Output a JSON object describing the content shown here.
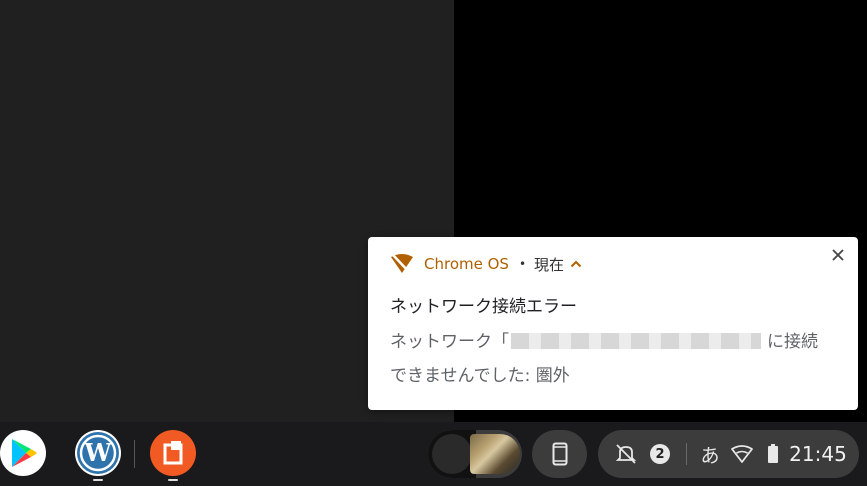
{
  "notification": {
    "app_name": "Chrome OS",
    "separator": "•",
    "time": "現在",
    "title": "ネットワーク接続エラー",
    "body_prefix": "ネットワーク「",
    "body_suffix": "に接続できませんでした: 圏外",
    "icons": {
      "app": "wifi-off-icon",
      "expand": "chevron-up-icon",
      "close": "close-icon"
    },
    "accent_color": "#b06000"
  },
  "shelf": {
    "apps": [
      {
        "name": "Google Play Store",
        "icon": "play-store-icon"
      },
      {
        "name": "WordPress",
        "icon": "wordpress-icon"
      },
      {
        "name": "App",
        "icon": "orange-app-icon"
      }
    ],
    "status": {
      "notification_count": "2",
      "ime": "あ",
      "time": "21:45",
      "icons": [
        "notifications-off-icon",
        "wifi-icon",
        "battery-icon"
      ]
    }
  }
}
